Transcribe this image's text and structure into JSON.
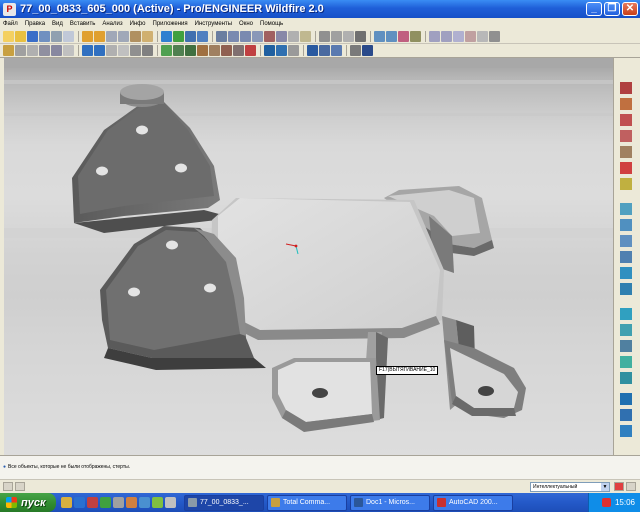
{
  "window": {
    "title": "77_00_0833_605_000 (Active) - Pro/ENGINEER Wildfire 2.0",
    "minimize_glyph": "_",
    "maximize_glyph": "❐",
    "close_glyph": "✕"
  },
  "menu": {
    "items": [
      "Файл",
      "Правка",
      "Вид",
      "Вставить",
      "Анализ",
      "Инфо",
      "Приложения",
      "Инструменты",
      "Окно",
      "Помощь"
    ]
  },
  "viewport": {
    "feature_tag": "F17(ВЫТЯГИВАНИЕ_10"
  },
  "message_area": {
    "message": "Все объекты, которые не были отображены, стерты."
  },
  "status_bar": {
    "filter_value": "Интеллектуальный"
  },
  "taskbar": {
    "start_label": "пуск",
    "tasks": [
      {
        "label": "77_00_0833_...",
        "active": true,
        "icon_color": "#8a9aa8"
      },
      {
        "label": "Total Comma...",
        "active": false,
        "icon_color": "#c8a040"
      },
      {
        "label": "Doc1 - Micros...",
        "active": false,
        "icon_color": "#2b579a"
      },
      {
        "label": "AutoCAD 200...",
        "active": false,
        "icon_color": "#c83030"
      }
    ],
    "clock": "15:06"
  }
}
